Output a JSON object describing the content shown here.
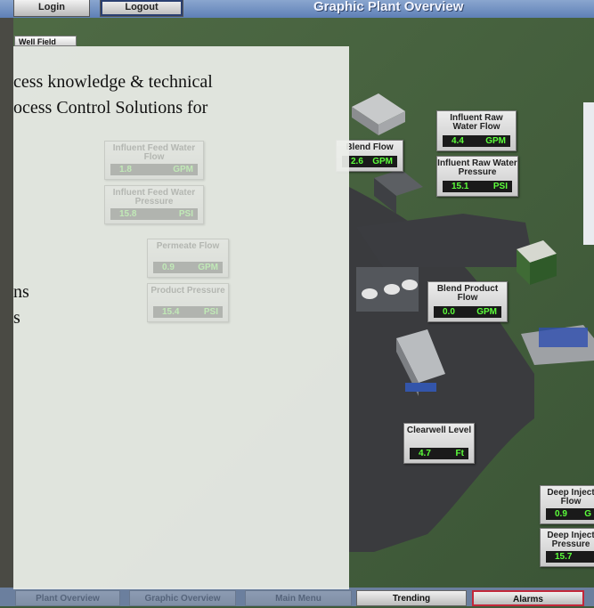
{
  "topbar": {
    "login_label": "Login",
    "logout_label": "Logout",
    "title": "Graphic Plant Overview"
  },
  "well_field_label": "Well Field",
  "panels": {
    "influent_raw_water_flow": {
      "label": "Influent Raw Water Flow",
      "value": "4.4",
      "unit": "GPM"
    },
    "blend_flow": {
      "label": "Blend Flow",
      "value": "2.6",
      "unit": "GPM"
    },
    "influent_raw_water_pressure": {
      "label": "Influent Raw Water Pressure",
      "value": "15.1",
      "unit": "PSI"
    },
    "blend_product_flow": {
      "label": "Blend Product Flow",
      "value": "0.0",
      "unit": "GPM"
    },
    "clearwell_level": {
      "label": "Clearwell Level",
      "value": "4.7",
      "unit": "Ft"
    },
    "deep_injection_flow": {
      "label": "Deep Inject Flow",
      "value": "0.9",
      "unit": "G"
    },
    "deep_injection_pressure": {
      "label": "Deep Inject Pressure",
      "value": "15.7",
      "unit": ""
    },
    "influent_feed_water_flow": {
      "label": "Influent Feed Water Flow",
      "value": "1.8",
      "unit": "GPM"
    },
    "influent_feed_water_pressure": {
      "label": "Influent Feed Water Pressure",
      "value": "15.8",
      "unit": "PSI"
    },
    "permeate_flow": {
      "label": "Permeate Flow",
      "value": "0.9",
      "unit": "GPM"
    },
    "product_pressure": {
      "label": "Product Pressure",
      "value": "15.4",
      "unit": "PSI"
    }
  },
  "bottom_nav": {
    "plant_overview": "Plant Overview",
    "graphic_overview": "Graphic Overview",
    "main_menu": "Main Menu",
    "trending": "Trending",
    "alarms": "Alarms"
  },
  "overlay": {
    "line1": "cess knowledge & technical",
    "line2": "ocess Control Solutions for",
    "line3": "ns",
    "line4": "s"
  },
  "colors": {
    "readout_text": "#5cff3b",
    "title_bar": "#6f8fc4",
    "alarm_border": "#c2273a"
  }
}
